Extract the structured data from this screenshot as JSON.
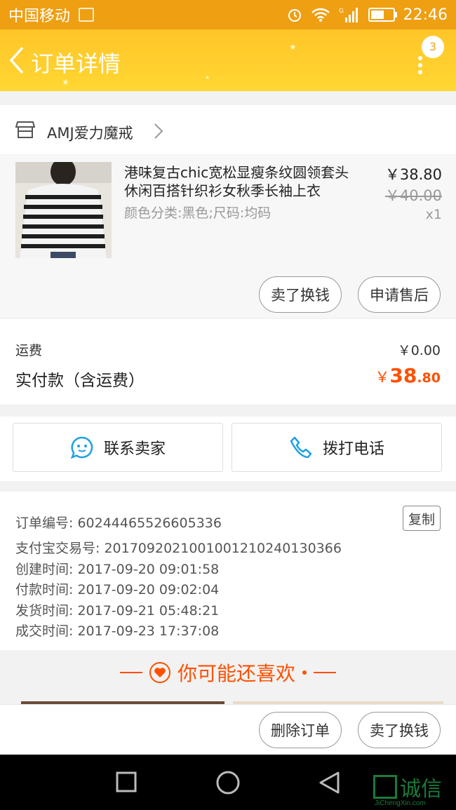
{
  "status_bar": {
    "carrier": "中国移动",
    "network": "G",
    "time": "22:46"
  },
  "header": {
    "title": "订单详情",
    "badge": "3"
  },
  "shop": {
    "name": "AMJ爱力魔戒"
  },
  "item": {
    "title": "港味复古chic宽松显瘦条纹圆领套头休闲百搭针织衫女秋季长袖上衣",
    "spec": "颜色分类:黑色;尺码:均码",
    "price": "￥38.80",
    "original_price": "￥40.00",
    "quantity": "x1",
    "actions": [
      "卖了换钱",
      "申请售后"
    ]
  },
  "fees": {
    "shipping_label": "运费",
    "shipping_value": "￥0.00",
    "paid_label": "实付款（含运费）",
    "paid_currency": "￥",
    "paid_integer": "38",
    "paid_decimal": ".80"
  },
  "contact": {
    "seller": "联系卖家",
    "call": "拨打电话"
  },
  "order_info": {
    "copy_label": "复制",
    "rows": [
      {
        "label": "订单编号:",
        "value": "60244465526605336"
      },
      {
        "label": "支付宝交易号:",
        "value": "2017092021001001210240130366"
      },
      {
        "label": "创建时间:",
        "value": "2017-09-20 09:01:58"
      },
      {
        "label": "付款时间:",
        "value": "2017-09-20 09:02:04"
      },
      {
        "label": "发货时间:",
        "value": "2017-09-21 05:48:21"
      },
      {
        "label": "成交时间:",
        "value": "2017-09-23 17:37:08"
      }
    ]
  },
  "recommend": {
    "title": "你可能还喜欢"
  },
  "bottom_actions": [
    "删除订单",
    "卖了换钱"
  ],
  "watermark": {
    "text": "诚信",
    "sub": "JiChengXin.com"
  },
  "colors": {
    "accent": "#ff5000",
    "header": "#ffc528",
    "status": "#ee9f12"
  }
}
